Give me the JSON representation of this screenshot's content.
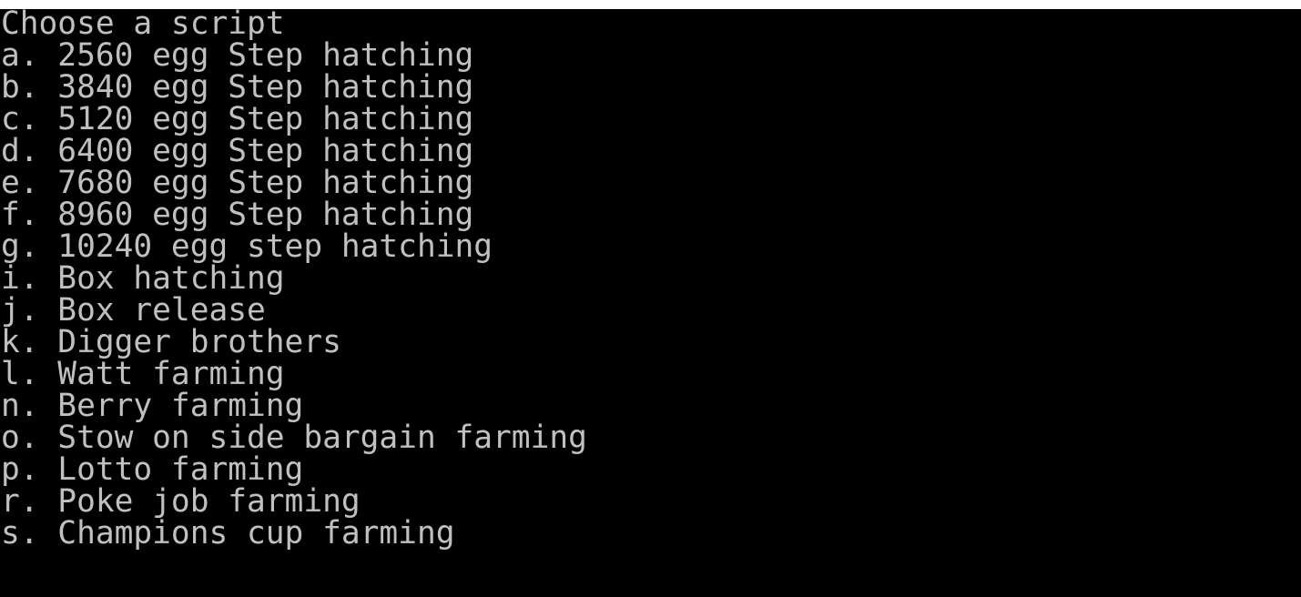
{
  "console": {
    "prompt": "Choose a script",
    "options": [
      "a. 2560 egg Step hatching",
      "b. 3840 egg Step hatching",
      "c. 5120 egg Step hatching",
      "d. 6400 egg Step hatching",
      "e. 7680 egg Step hatching",
      "f. 8960 egg Step hatching",
      "g. 10240 egg step hatching",
      "i. Box hatching",
      "j. Box release",
      "k. Digger brothers",
      "l. Watt farming",
      "n. Berry farming",
      "o. Stow on side bargain farming",
      "p. Lotto farming",
      "r. Poke job farming",
      "s. Champions cup farming"
    ],
    "colors": {
      "background": "#000000",
      "text": "#c0c0c0"
    }
  }
}
